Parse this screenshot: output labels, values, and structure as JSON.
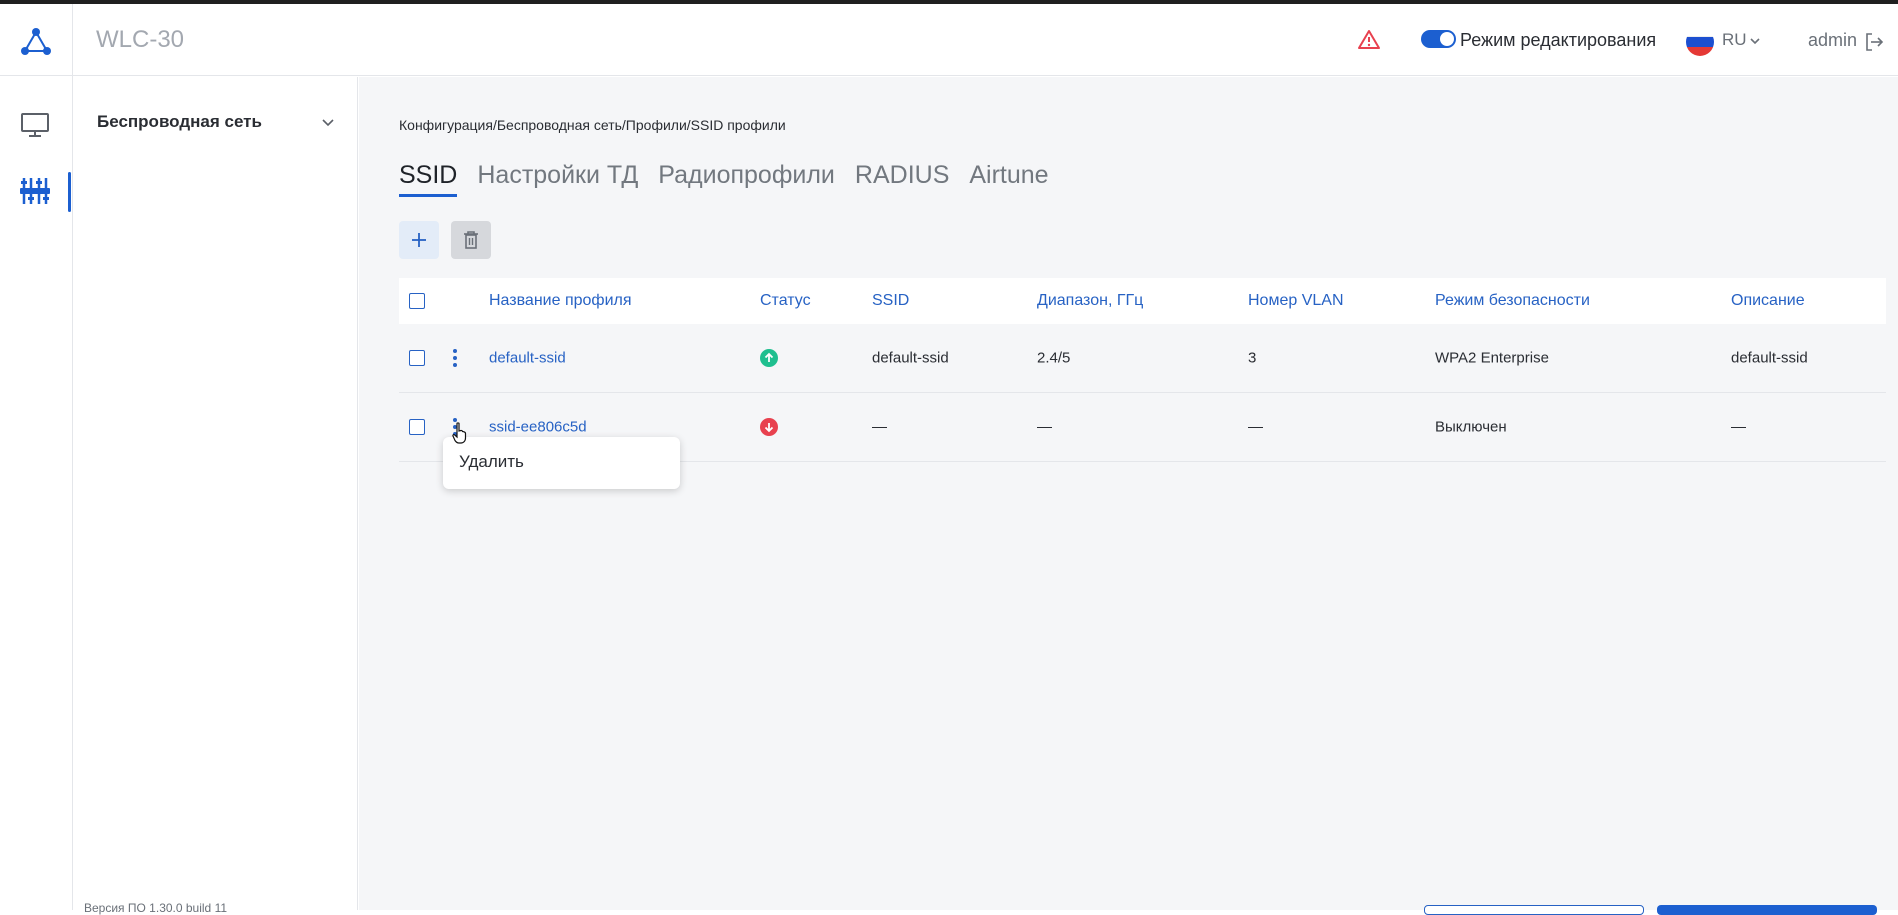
{
  "app": {
    "title": "WLC-30"
  },
  "header": {
    "edit_mode_label": "Режим редактирования",
    "edit_mode_enabled": true,
    "language": "RU",
    "user": "admin"
  },
  "sidebar": {
    "section": "Беспроводная сеть",
    "footer": "Версия ПО 1.30.0 build 11"
  },
  "breadcrumb": "Конфигурация/Беспроводная сеть/Профили/SSID профили",
  "tabs": [
    {
      "label": "SSID",
      "active": true
    },
    {
      "label": "Настройки ТД",
      "active": false
    },
    {
      "label": "Радиопрофили",
      "active": false
    },
    {
      "label": "RADIUS",
      "active": false
    },
    {
      "label": "Airtune",
      "active": false
    }
  ],
  "table": {
    "headers": {
      "name": "Название профиля",
      "status": "Статус",
      "ssid": "SSID",
      "band": "Диапазон, ГГц",
      "vlan": "Номер VLAN",
      "security": "Режим безопасности",
      "description": "Описание"
    },
    "rows": [
      {
        "name": "default-ssid",
        "status": "up",
        "ssid": "default-ssid",
        "band": "2.4/5",
        "vlan": "3",
        "security": "WPA2 Enterprise",
        "description": "default-ssid"
      },
      {
        "name": "ssid-ee806c5d",
        "status": "down",
        "ssid": "—",
        "band": "—",
        "vlan": "—",
        "security": "Выключен",
        "description": "—"
      }
    ]
  },
  "context_menu": {
    "delete_label": "Удалить"
  },
  "colors": {
    "accent": "#1c5fd0",
    "status_up": "#1fbf8f",
    "status_down": "#e8414f",
    "warning": "#e8414f"
  }
}
